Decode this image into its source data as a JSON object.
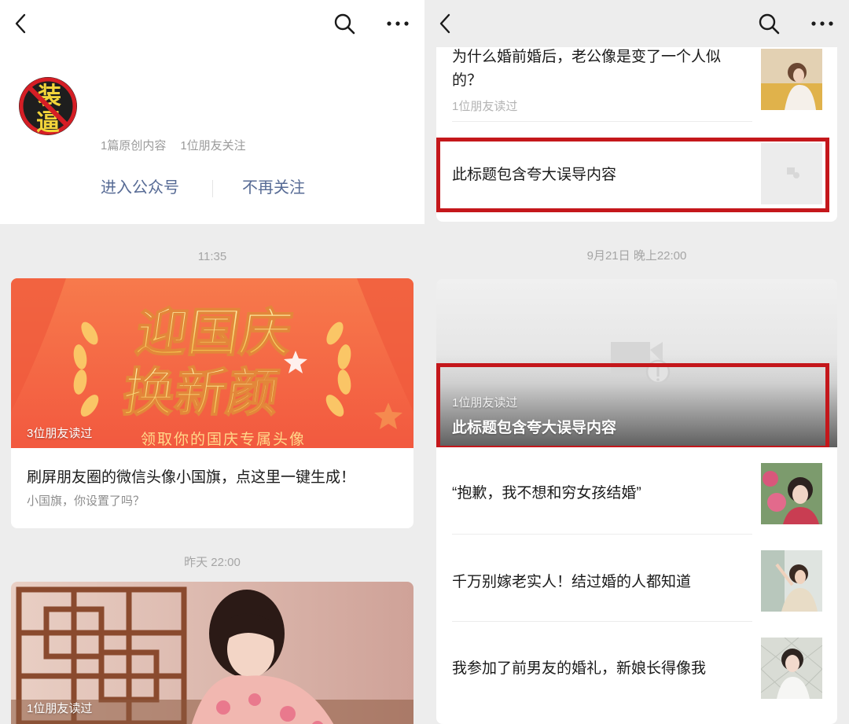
{
  "left": {
    "profile": {
      "avatar_text_top": "装",
      "avatar_text_bottom": "逼",
      "original_count": "1篇原创内容",
      "friends_following": "1位朋友关注",
      "enter_label": "进入公众号",
      "unfollow_label": "不再关注"
    },
    "feed": [
      {
        "time": "11:35",
        "banner_line1": "迎国庆",
        "banner_line2": "换新颜",
        "banner_caption": "领取你的国庆专属头像",
        "read_count": "3位朋友读过",
        "title": "刷屏朋友圈的微信头像小国旗，点这里一键生成！",
        "desc": "小国旗，你设置了吗？"
      },
      {
        "time": "昨天 22:00",
        "read_count": "1位朋友读过"
      }
    ]
  },
  "right": {
    "top_card": [
      {
        "title": "为什么婚前婚后，老公像是变了一个人似的？",
        "read_count": "1位朋友读过"
      },
      {
        "title": "此标题包含夸大误导内容"
      }
    ],
    "time": "9月21日 晚上22:00",
    "cover": {
      "read_count": "1位朋友读过",
      "title": "此标题包含夸大误导内容"
    },
    "items": [
      {
        "title": "“抱歉，我不想和穷女孩结婚”"
      },
      {
        "title": "千万别嫁老实人！结过婚的人都知道"
      },
      {
        "title": "我参加了前男友的婚礼，新娘长得像我"
      }
    ]
  },
  "colors": {
    "link_blue": "#576b95",
    "highlight_red": "#c4171b",
    "background": "#ededed"
  },
  "icons": [
    "back-icon",
    "search-icon",
    "more-icon",
    "image-placeholder-icon"
  ]
}
